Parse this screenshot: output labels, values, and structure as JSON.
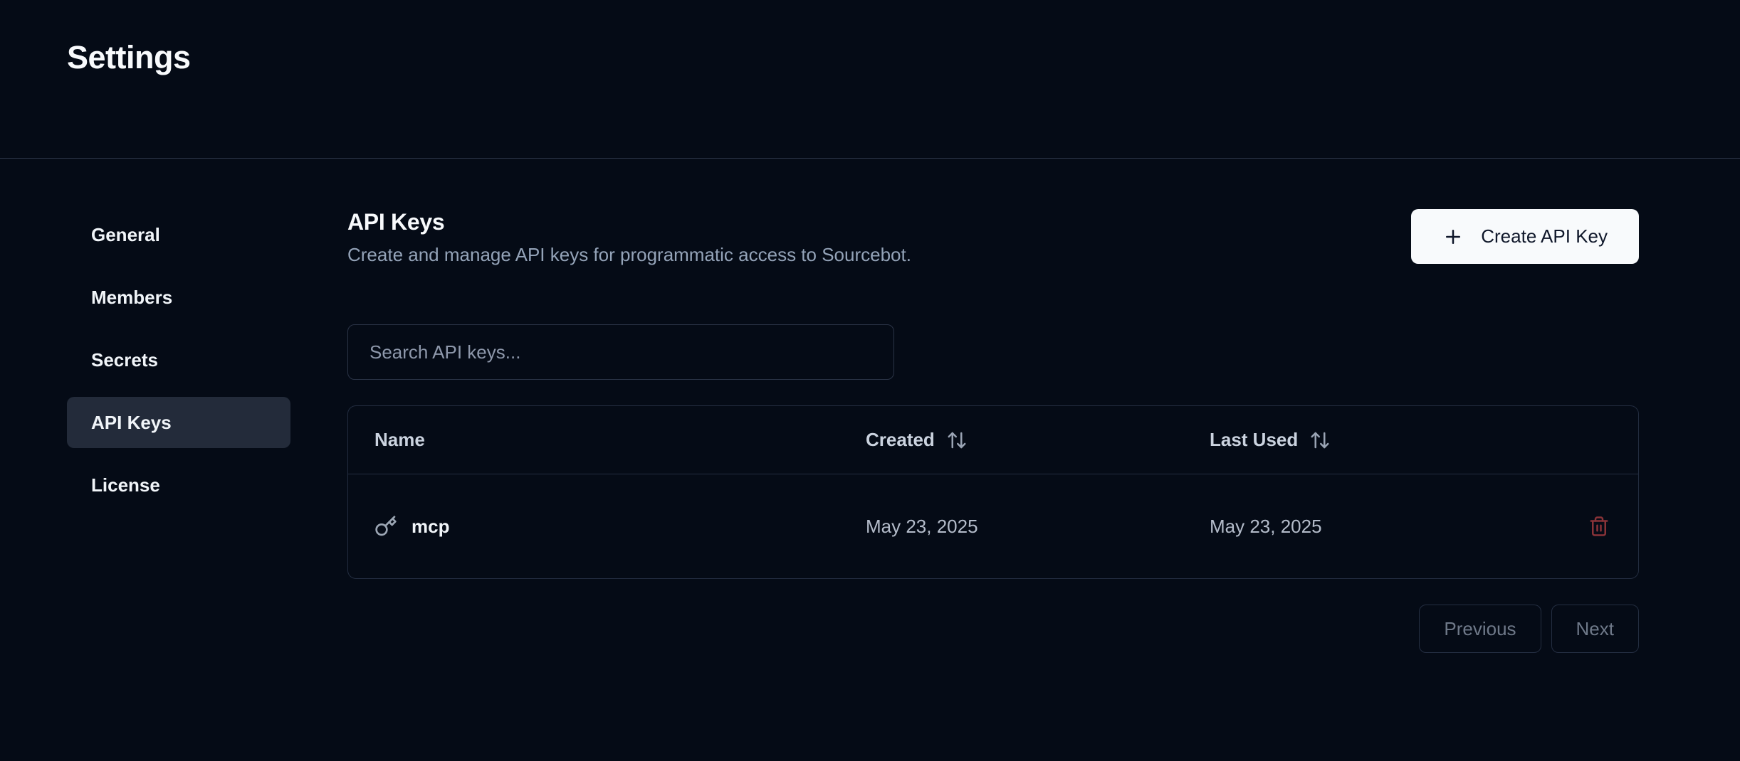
{
  "page": {
    "title": "Settings"
  },
  "sidebar": {
    "items": [
      {
        "label": "General",
        "active": false
      },
      {
        "label": "Members",
        "active": false
      },
      {
        "label": "Secrets",
        "active": false
      },
      {
        "label": "API Keys",
        "active": true
      },
      {
        "label": "License",
        "active": false
      }
    ]
  },
  "main": {
    "title": "API Keys",
    "subtitle": "Create and manage API keys for programmatic access to Sourcebot.",
    "create_button_label": "Create API Key",
    "search": {
      "placeholder": "Search API keys...",
      "value": ""
    },
    "table": {
      "columns": [
        {
          "label": "Name",
          "sortable": false
        },
        {
          "label": "Created",
          "sortable": true
        },
        {
          "label": "Last Used",
          "sortable": true
        }
      ],
      "rows": [
        {
          "name": "mcp",
          "created": "May 23, 2025",
          "last_used": "May 23, 2025"
        }
      ]
    },
    "pagination": {
      "previous_label": "Previous",
      "next_label": "Next"
    }
  },
  "icons": {
    "create_button": "plus-icon",
    "row_key": "key-icon",
    "row_delete": "trash-icon",
    "column_sort": "arrow-up-down-icon"
  },
  "colors": {
    "background": "#050B16",
    "header_border": "#2E3749",
    "panel_border": "#232D40",
    "active_item_bg": "#232B3A",
    "accent_button_bg": "#F8FAFC",
    "accent_button_text": "#0F172A",
    "muted_text": "#94A3B8",
    "destructive_icon": "#8A3338"
  }
}
